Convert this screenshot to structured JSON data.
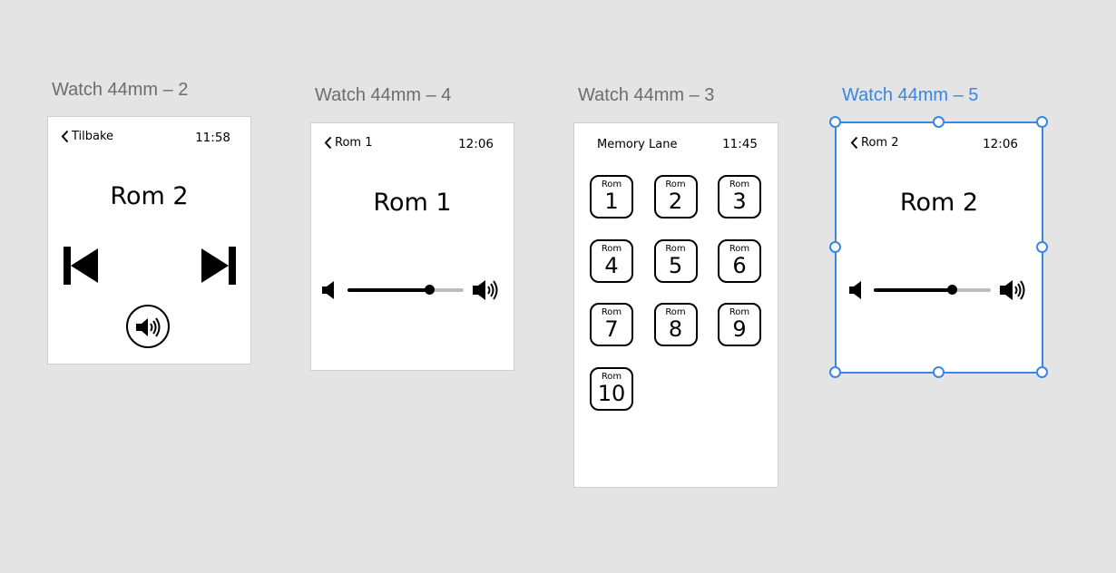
{
  "artboards": [
    {
      "title": "Watch 44mm – 2",
      "back_label": "Tilbake",
      "time": "11:58",
      "room": "Rom 2"
    },
    {
      "title": "Watch 44mm – 4",
      "back_label": "Rom 1",
      "time": "12:06",
      "room": "Rom 1",
      "volume": 0.7
    },
    {
      "title": "Watch 44mm – 3",
      "header": "Memory Lane",
      "time": "11:45",
      "room_label": "Rom",
      "rooms": [
        "1",
        "2",
        "3",
        "4",
        "5",
        "6",
        "7",
        "8",
        "9",
        "10"
      ]
    },
    {
      "title": "Watch 44mm – 5",
      "back_label": "Rom 2",
      "time": "12:06",
      "room": "Rom 2",
      "volume": 0.67,
      "selected": true
    }
  ],
  "colors": {
    "selection": "#3a86e0",
    "canvas": "#e4e4e4"
  },
  "icons": [
    "chevron-left-icon",
    "skip-previous-icon",
    "skip-next-icon",
    "speaker-icon",
    "volume-low-icon",
    "volume-high-icon"
  ]
}
